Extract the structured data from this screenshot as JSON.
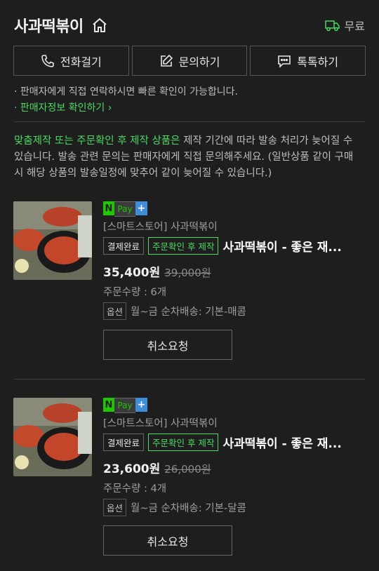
{
  "header": {
    "title": "사과떡볶이",
    "delivery_label": "무료"
  },
  "contact_buttons": [
    {
      "label": "전화걸기",
      "icon": "phone-icon"
    },
    {
      "label": "문의하기",
      "icon": "edit-icon"
    },
    {
      "label": "톡톡하기",
      "icon": "chat-icon"
    }
  ],
  "notes": {
    "line1": "· 판매자에게 직접 연락하시면 빠른 확인이 가능합니다.",
    "line2": "· 판매자정보 확인하기 ›"
  },
  "notice": {
    "highlight": "맞춤제작 또는 주문확인 후 제작 상품은",
    "rest": " 제작 기간에 따라 발송 처리가 늦어질 수 있습니다. 발송 관련 문의는 판매자에게 직접 문의해주세요. (일반상품 같이 구매 시 해당 상품의 발송일정에 맞추어 같이 늦어질 수 있습니다.)"
  },
  "orders": [
    {
      "pay_badge": {
        "n": "N",
        "pay": "Pay",
        "plus": "+"
      },
      "store": "[스마트스토어] 사과떡볶이",
      "status_badge": "결제완료",
      "made_badge": "주문확인 후 제작",
      "product_name": "사과떡볶이 - 좋은 재...",
      "price": "35,400원",
      "original_price": "39,000원",
      "quantity": "주문수량 : 6개",
      "option_tag": "옵션",
      "option_value": "월~금 순차배송: 기본-매콤",
      "cancel_label": "취소요청"
    },
    {
      "pay_badge": {
        "n": "N",
        "pay": "Pay",
        "plus": "+"
      },
      "store": "[스마트스토어] 사과떡볶이",
      "status_badge": "결제완료",
      "made_badge": "주문확인 후 제작",
      "product_name": "사과떡볶이 - 좋은 재...",
      "price": "23,600원",
      "original_price": "26,000원",
      "quantity": "주문수량 : 4개",
      "option_tag": "옵션",
      "option_value": "월~금 순차배송: 기본-달콤",
      "cancel_label": "취소요청"
    }
  ],
  "colors": {
    "background": "#1e1e1e",
    "accent_green": "#4cd964",
    "npay_green": "#1ec800",
    "npay_blue": "#3f8cd9"
  }
}
